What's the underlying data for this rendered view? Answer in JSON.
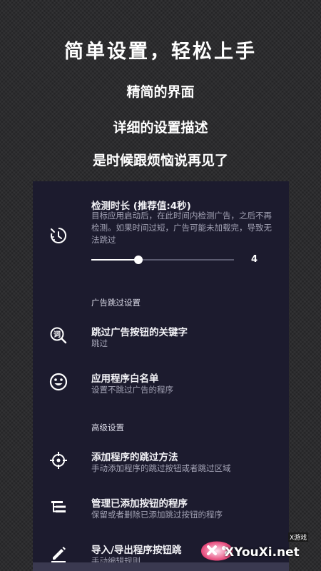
{
  "hero": {
    "title": "简单设置，轻松上手",
    "line1": "精简的界面",
    "line2": "详细的设置描述",
    "line3": "是时候跟烦恼说再见了"
  },
  "detection": {
    "title": "检测时长 (推荐值:4秒)",
    "desc": "目标应用启动后，在此时间内检测广告，之后不再检测。如果时间过短，广告可能未加载完，导致无法跳过",
    "slider_value": "4",
    "slider_fraction": 0.33,
    "icon": "timer-icon"
  },
  "section_ad": {
    "label": "广告跳过设置"
  },
  "keywords": {
    "title": "跳过广告按钮的关键字",
    "desc": "跳过",
    "icon": "word-search-icon"
  },
  "whitelist": {
    "title": "应用程序白名单",
    "desc": "设置不跳过广告的程序",
    "icon": "smiley-icon"
  },
  "section_adv": {
    "label": "高级设置"
  },
  "add_method": {
    "title": "添加程序的跳过方法",
    "desc": "手动添加程序的跳过按钮或者跳过区域",
    "icon": "crosshair-icon"
  },
  "manage": {
    "title": "管理已添加按钮的程序",
    "desc": "保留或者删除已添加跳过按钮的程序",
    "icon": "tree-list-icon"
  },
  "import_export": {
    "title": "导入/导出程序按钮跳",
    "desc": "手动编辑规则",
    "icon": "pencil-icon"
  },
  "watermark": {
    "text": "XYouXi.net",
    "sub": "X游戏"
  },
  "colors": {
    "panel": "#1c1b2e",
    "text": "#f2f2f6",
    "desc": "#a3a3b5"
  }
}
